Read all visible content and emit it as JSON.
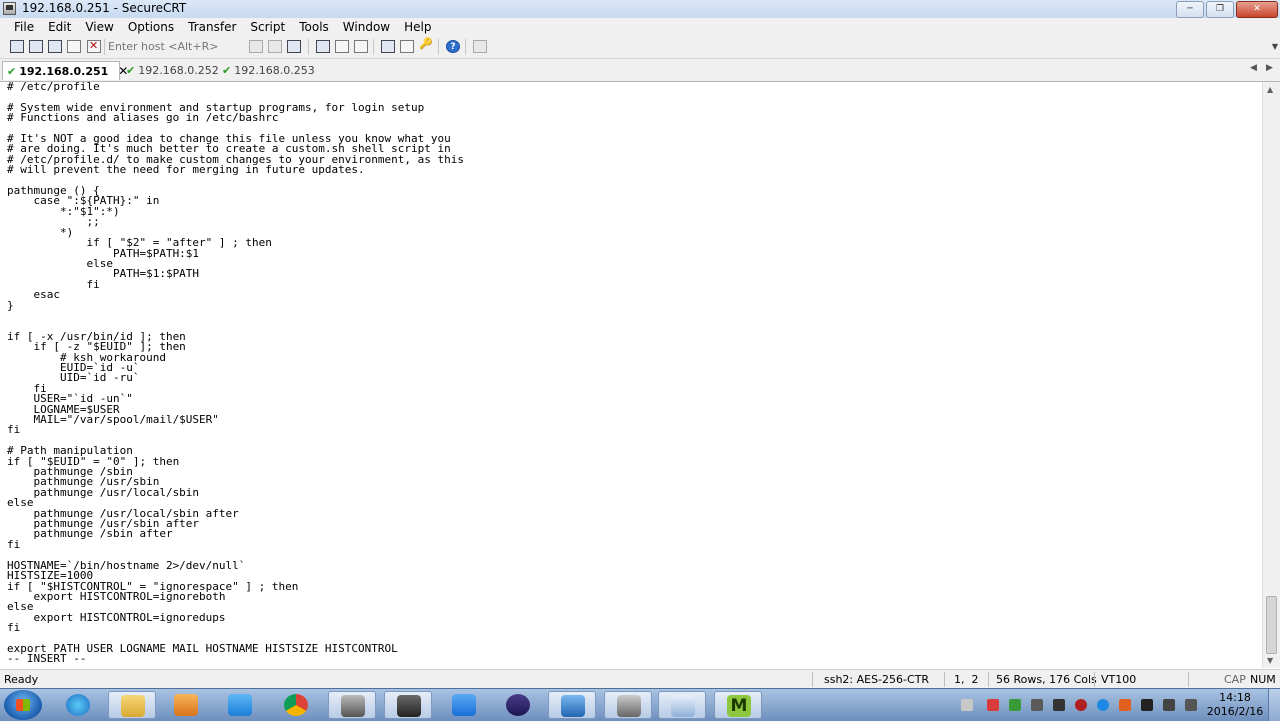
{
  "window": {
    "title": "192.168.0.251 - SecureCRT"
  },
  "menubar": {
    "items": [
      "File",
      "Edit",
      "View",
      "Options",
      "Transfer",
      "Script",
      "Tools",
      "Window",
      "Help"
    ]
  },
  "toolbar": {
    "host_placeholder": "Enter host <Alt+R>"
  },
  "tabs": [
    {
      "label": "192.168.0.251",
      "active": true,
      "status": "connected"
    },
    {
      "label": "192.168.0.252",
      "active": false,
      "status": "connected"
    },
    {
      "label": "192.168.0.253",
      "active": false,
      "status": "connected"
    }
  ],
  "terminal": {
    "lines": [
      "# /etc/profile",
      "",
      "# System wide environment and startup programs, for login setup",
      "# Functions and aliases go in /etc/bashrc",
      "",
      "# It's NOT a good idea to change this file unless you know what you",
      "# are doing. It's much better to create a custom.sh shell script in",
      "# /etc/profile.d/ to make custom changes to your environment, as this",
      "# will prevent the need for merging in future updates.",
      "",
      "pathmunge () {",
      "    case \":${PATH}:\" in",
      "        *:\"$1\":*)",
      "            ;;",
      "        *)",
      "            if [ \"$2\" = \"after\" ] ; then",
      "                PATH=$PATH:$1",
      "            else",
      "                PATH=$1:$PATH",
      "            fi",
      "    esac",
      "}",
      "",
      "",
      "if [ -x /usr/bin/id ]; then",
      "    if [ -z \"$EUID\" ]; then",
      "        # ksh workaround",
      "        EUID=`id -u`",
      "        UID=`id -ru`",
      "    fi",
      "    USER=\"`id -un`\"",
      "    LOGNAME=$USER",
      "    MAIL=\"/var/spool/mail/$USER\"",
      "fi",
      "",
      "# Path manipulation",
      "if [ \"$EUID\" = \"0\" ]; then",
      "    pathmunge /sbin",
      "    pathmunge /usr/sbin",
      "    pathmunge /usr/local/sbin",
      "else",
      "    pathmunge /usr/local/sbin after",
      "    pathmunge /usr/sbin after",
      "    pathmunge /sbin after",
      "fi",
      "",
      "HOSTNAME=`/bin/hostname 2>/dev/null`",
      "HISTSIZE=1000",
      "if [ \"$HISTCONTROL\" = \"ignorespace\" ] ; then",
      "    export HISTCONTROL=ignoreboth",
      "else",
      "    export HISTCONTROL=ignoredups",
      "fi",
      "",
      "export PATH USER LOGNAME MAIL HOSTNAME HISTSIZE HISTCONTROL",
      "-- INSERT --"
    ]
  },
  "statusbar": {
    "state": "Ready",
    "cipher": "ssh2: AES-256-CTR",
    "cursor": "1,  2",
    "size": "56 Rows, 176 Cols",
    "terminal_type": "VT100",
    "caps": "CAP",
    "num": "NUM"
  },
  "taskbar": {
    "clock_time": "14:18",
    "clock_date": "2016/2/16"
  },
  "colors": {
    "tab_check": "#2a9d2a",
    "taskbar": "#8aa8d0",
    "terminal_bg": "#ffffff"
  }
}
